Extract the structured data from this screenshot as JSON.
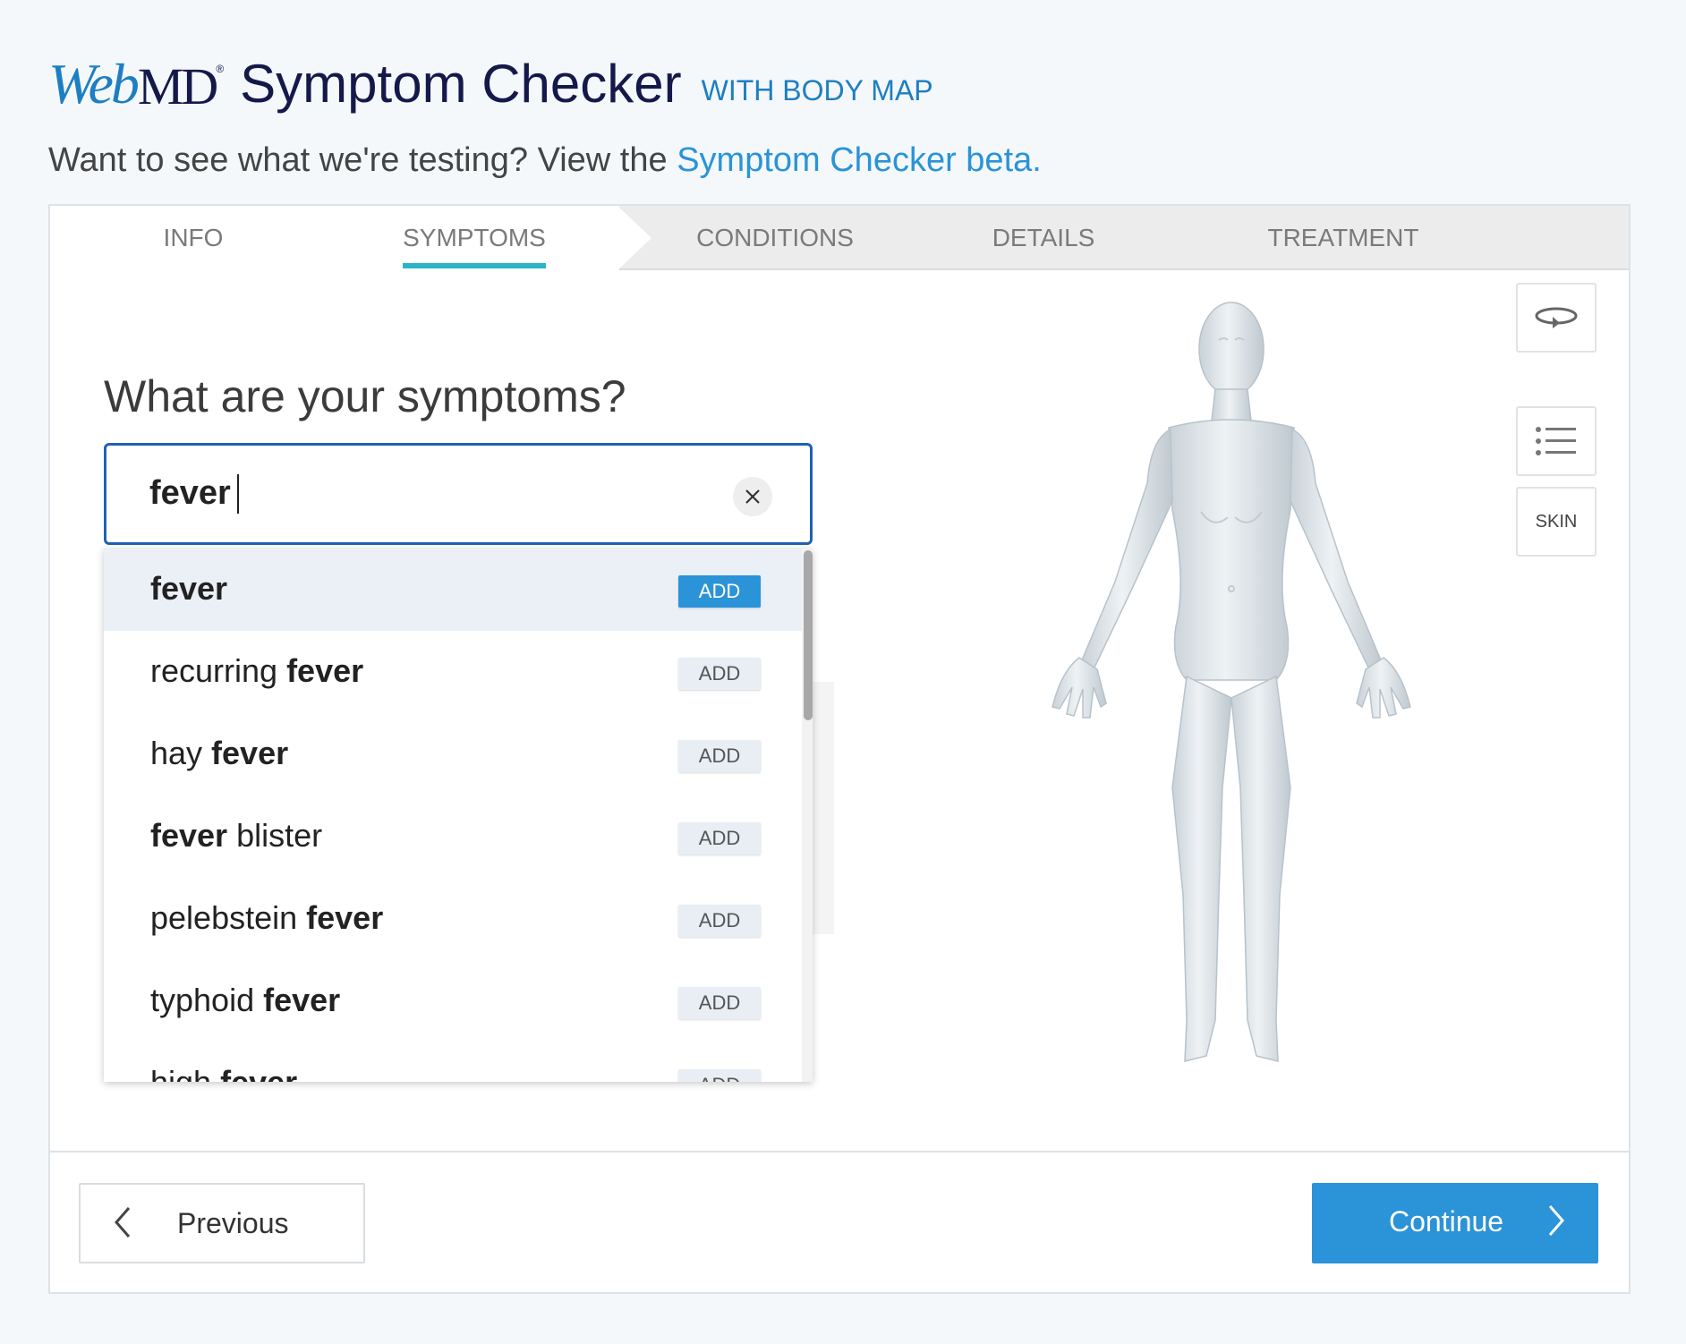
{
  "header": {
    "logo_web": "Web",
    "logo_md": "MD",
    "logo_reg": "®",
    "title": "Symptom Checker",
    "tag": "WITH BODY MAP",
    "subtitle_text": "Want to see what we're testing? View the",
    "subtitle_link": "Symptom Checker beta."
  },
  "steps": [
    "INFO",
    "SYMPTOMS",
    "CONDITIONS",
    "DETAILS",
    "TREATMENT"
  ],
  "active_step": "SYMPTOMS",
  "question": "What are your symptoms?",
  "search": {
    "value": "fever"
  },
  "suggestions": [
    {
      "pre": "",
      "bold": "fever",
      "post": "",
      "add": "ADD",
      "highlighted": true
    },
    {
      "pre": "recurring ",
      "bold": "fever",
      "post": "",
      "add": "ADD"
    },
    {
      "pre": "hay ",
      "bold": "fever",
      "post": "",
      "add": "ADD"
    },
    {
      "pre": "",
      "bold": "fever",
      "post": " blister",
      "add": "ADD"
    },
    {
      "pre": "pelebstein ",
      "bold": "fever",
      "post": "",
      "add": "ADD"
    },
    {
      "pre": "typhoid ",
      "bold": "fever",
      "post": "",
      "add": "ADD"
    },
    {
      "pre": "high ",
      "bold": "fever",
      "post": "",
      "add": "ADD"
    }
  ],
  "tools": {
    "skin": "SKIN"
  },
  "footer": {
    "previous": "Previous",
    "continue": "Continue"
  },
  "colors": {
    "accent": "#2b93d8",
    "brand_navy": "#15194a",
    "active_tab": "#2ab4c9",
    "search_border": "#1d62b5"
  },
  "icons": [
    "rotate-icon",
    "list-icon",
    "clear-icon",
    "chevron-left-icon",
    "chevron-right-icon"
  ]
}
